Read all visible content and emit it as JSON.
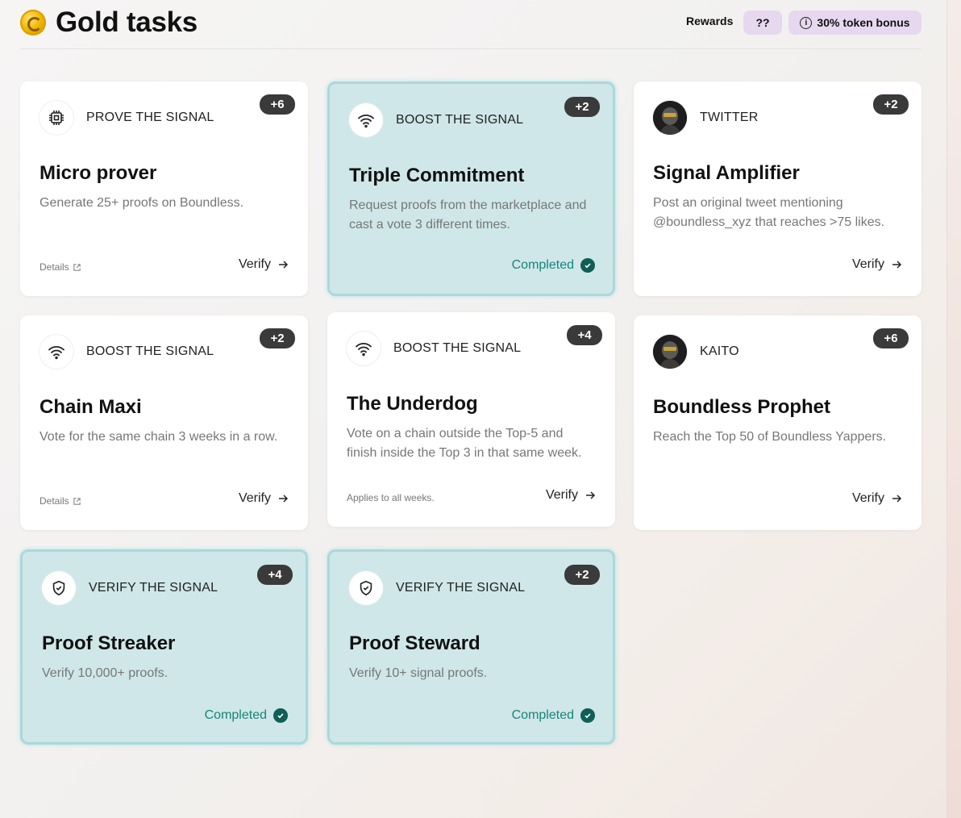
{
  "header": {
    "title": "Gold tasks",
    "rewards_label": "Rewards",
    "rewards_value": "??",
    "bonus_label": "30% token bonus",
    "info_glyph": "i"
  },
  "common": {
    "verify_label": "Verify",
    "details_label": "Details",
    "completed_label": "Completed"
  },
  "colors": {
    "completed_bg": "#cfe7e8",
    "completed_text": "#17857a",
    "badge_bg": "#3a3a3a",
    "pill_bg": "#e6d8ee"
  },
  "tasks": [
    {
      "points": "+6",
      "category": "PROVE THE SIGNAL",
      "icon": "chip-icon",
      "title": "Micro prover",
      "description": "Generate 25+ proofs on Boundless.",
      "status": "verify",
      "footer": "Details"
    },
    {
      "points": "+2",
      "category": "BOOST THE SIGNAL",
      "icon": "wifi-icon",
      "title": "Triple Commitment",
      "description": "Request proofs from the marketplace and cast a vote 3 different times.",
      "status": "completed"
    },
    {
      "points": "+2",
      "category": "TWITTER",
      "icon": "avatar-icon",
      "title": "Signal Amplifier",
      "description": "Post an original tweet mentioning @boundless_xyz that reaches >75 likes.",
      "status": "verify"
    },
    {
      "points": "+2",
      "category": "BOOST THE SIGNAL",
      "icon": "wifi-icon",
      "title": "Chain Maxi",
      "description": "Vote for the same chain 3 weeks in a row.",
      "status": "verify",
      "footer": "Details"
    },
    {
      "points": "+4",
      "category": "BOOST THE SIGNAL",
      "icon": "wifi-icon",
      "title": "The Underdog",
      "description": "Vote on a chain outside the Top-5 and finish inside the Top 3 in that same week.",
      "status": "verify",
      "footer": "Applies to all weeks."
    },
    {
      "points": "+6",
      "category": "KAITO",
      "icon": "avatar-icon",
      "title": "Boundless Prophet",
      "description": "Reach the Top 50 of Boundless Yappers.",
      "status": "verify"
    },
    {
      "points": "+4",
      "category": "VERIFY THE SIGNAL",
      "icon": "shield-icon",
      "title": "Proof Streaker",
      "description": "Verify 10,000+ proofs.",
      "status": "completed"
    },
    {
      "points": "+2",
      "category": "VERIFY THE SIGNAL",
      "icon": "shield-icon",
      "title": "Proof Steward",
      "description": "Verify 10+ signal proofs.",
      "status": "completed"
    }
  ]
}
